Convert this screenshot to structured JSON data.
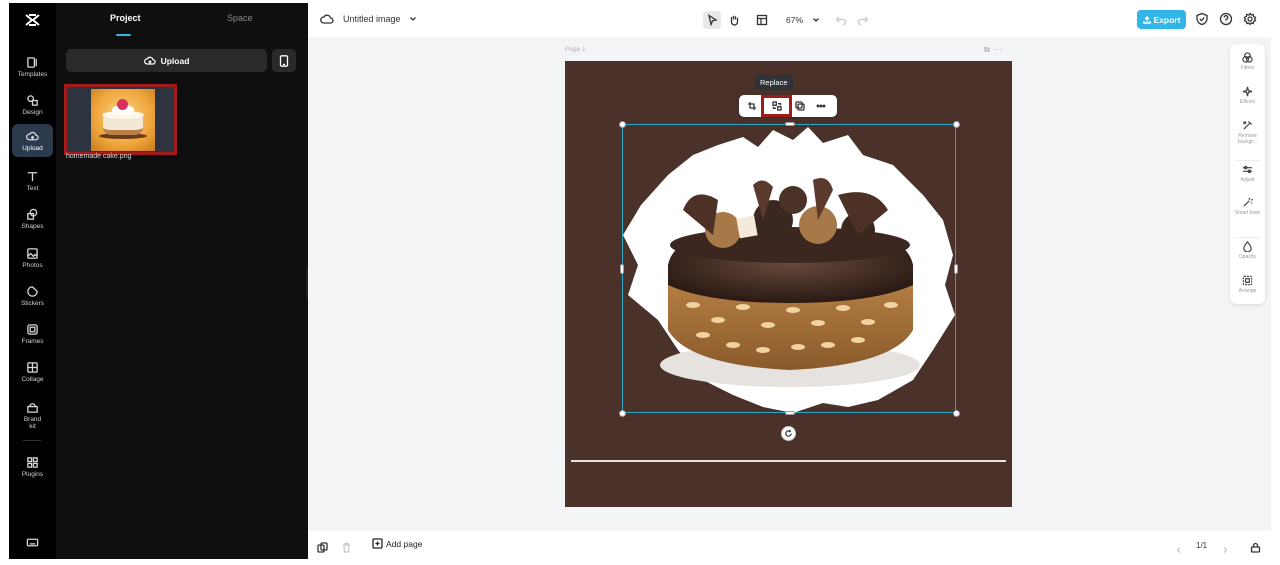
{
  "rail": {
    "items": [
      {
        "label": "Templates",
        "icon": "templates-icon"
      },
      {
        "label": "Design",
        "icon": "design-icon"
      },
      {
        "label": "Upload",
        "icon": "upload-icon",
        "active": true
      },
      {
        "label": "Text",
        "icon": "text-icon"
      },
      {
        "label": "Shapes",
        "icon": "shapes-icon"
      },
      {
        "label": "Photos",
        "icon": "photos-icon"
      },
      {
        "label": "Stickers",
        "icon": "stickers-icon"
      },
      {
        "label": "Frames",
        "icon": "frames-icon"
      },
      {
        "label": "Collage",
        "icon": "collage-icon"
      },
      {
        "label": "Brand kit",
        "icon": "brand-kit-icon"
      },
      {
        "label": "Plugins",
        "icon": "plugins-icon"
      }
    ]
  },
  "panel": {
    "tabs": [
      "Project",
      "Space"
    ],
    "upload_label": "Upload",
    "file_name": "homemade cake.png"
  },
  "topbar": {
    "title": "Untitled image",
    "zoom": "67%",
    "export_label": "Export"
  },
  "canvas": {
    "page_label": "Page 1",
    "tooltip": "Replace",
    "more": "···"
  },
  "props": {
    "items": [
      "Filters",
      "Effects",
      "Remove backgr...",
      "Adjust",
      "Smart tools",
      "Opacity",
      "Arrange"
    ]
  },
  "bottombar": {
    "add_page": "Add page",
    "pager": "1/1"
  },
  "colors": {
    "accent": "#2fb5e8",
    "artboard_bg": "#4a322b",
    "selection": "#28a5c8",
    "highlight": "#a11b1b"
  }
}
